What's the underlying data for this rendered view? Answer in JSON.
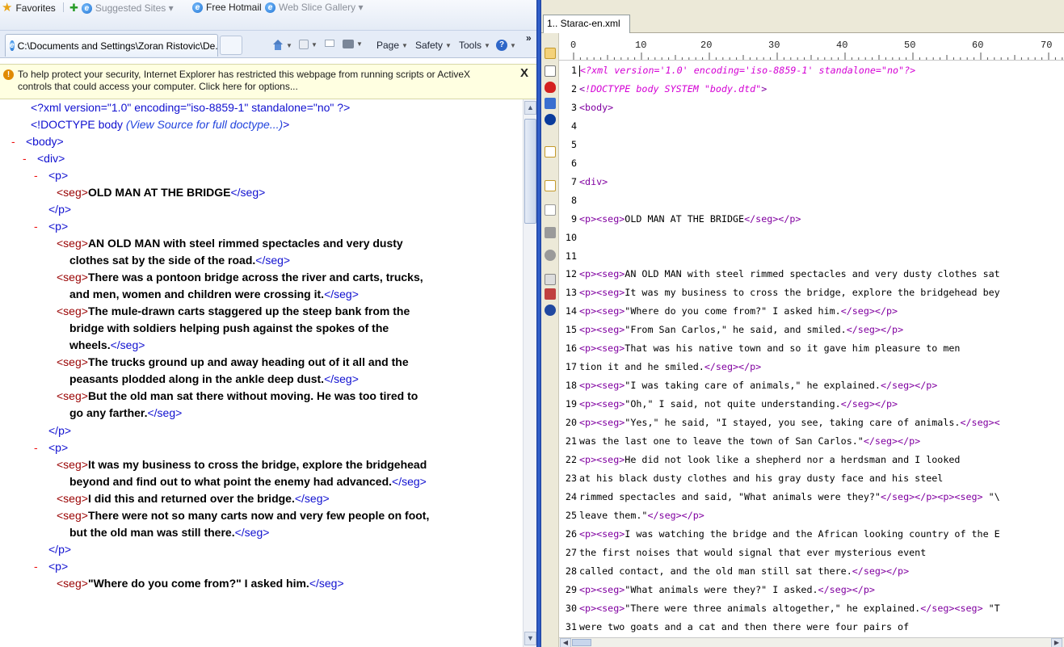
{
  "ie": {
    "favorites_bar": {
      "favorites_label": "Favorites",
      "suggested_sites": "Suggested Sites ▾",
      "free_hotmail": "Free Hotmail",
      "web_slice_gallery": "Web Slice Gallery ▾"
    },
    "tab": {
      "title": "C:\\Documents and Settings\\Zoran Ristovic\\De..."
    },
    "command_bar": {
      "page": "Page",
      "safety": "Safety",
      "tools": "Tools",
      "overflow": "»"
    },
    "info_bar": {
      "message": "To help protect your security, Internet Explorer has restricted this webpage from running scripts or ActiveX controls that could access your computer. Click here for options...",
      "close": "X"
    },
    "xml": {
      "decl": "<?xml version=\"1.0\" encoding=\"iso-8859-1\" standalone=\"no\" ?>",
      "doctype_open": "<!DOCTYPE body ",
      "doctype_note": "(View Source for full doctype...)",
      "doctype_close": ">",
      "collapse_marker": "-",
      "body_open": "<body>",
      "div_open": "<div>",
      "p_open": "<p>",
      "p_close": "</p>",
      "seg_open": "<seg>",
      "seg_close": "</seg>",
      "segs": [
        "OLD MAN AT THE BRIDGE",
        "AN OLD MAN with steel rimmed spectacles and very dusty",
        "clothes sat by the side of the road.",
        "There was a pontoon bridge across the river and carts, trucks,",
        "and men, women and children were crossing it.",
        "The mule-drawn carts staggered up the steep bank from the",
        "bridge with soldiers helping push against the spokes of the",
        "wheels.",
        "The trucks ground up and away heading out of it all and the",
        "peasants plodded along in the ankle deep dust.",
        "But the old man sat there without moving. He was too tired to",
        "go any farther.",
        "It was my business to cross the bridge, explore the bridgehead",
        "beyond and find out to what point the enemy had advanced.",
        "I did this and returned over the bridge.",
        "There were not so many carts now and very few people on foot,",
        "but the old man was still there.",
        "\"Where do you come from?\" I asked him."
      ]
    }
  },
  "editor": {
    "tab_title": "1.. Starac-en.xml",
    "ruler_labels": [
      "0",
      "10",
      "20",
      "30",
      "40",
      "50",
      "60",
      "70"
    ],
    "lines": [
      {
        "n": "1",
        "parts": [
          {
            "c": "pi",
            "t": "<?xml version='1.0' encoding='iso-8859-1' standalone=\"no\"?>"
          }
        ]
      },
      {
        "n": "2",
        "parts": [
          {
            "c": "mt",
            "t": "<"
          },
          {
            "c": "pi",
            "t": "!DOCTYPE body SYSTEM \"body.dtd\""
          },
          {
            "c": "mt",
            "t": ">"
          }
        ]
      },
      {
        "n": "3",
        "parts": [
          {
            "c": "mt",
            "t": "<body>"
          }
        ]
      },
      {
        "n": "4",
        "parts": []
      },
      {
        "n": "5",
        "parts": []
      },
      {
        "n": "6",
        "parts": []
      },
      {
        "n": "7",
        "parts": [
          {
            "c": "mt",
            "t": "<div>"
          }
        ]
      },
      {
        "n": "8",
        "parts": []
      },
      {
        "n": "9",
        "parts": [
          {
            "c": "mt",
            "t": "<p><seg>"
          },
          {
            "c": "tx",
            "t": "OLD MAN AT THE BRIDGE"
          },
          {
            "c": "mt",
            "t": "</seg></p>"
          }
        ]
      },
      {
        "n": "10",
        "parts": []
      },
      {
        "n": "11",
        "parts": []
      },
      {
        "n": "12",
        "parts": [
          {
            "c": "mt",
            "t": "<p><seg>"
          },
          {
            "c": "tx",
            "t": "AN OLD MAN with steel rimmed spectacles and very dusty clothes sat"
          }
        ]
      },
      {
        "n": "13",
        "parts": [
          {
            "c": "mt",
            "t": "<p><seg>"
          },
          {
            "c": "tx",
            "t": "It was my business to cross the bridge, explore the bridgehead bey"
          }
        ]
      },
      {
        "n": "14",
        "parts": [
          {
            "c": "mt",
            "t": "<p><seg>"
          },
          {
            "c": "tx",
            "t": "\"Where do you come from?\" I asked him."
          },
          {
            "c": "mt",
            "t": "</seg></p>"
          }
        ]
      },
      {
        "n": "15",
        "parts": [
          {
            "c": "mt",
            "t": "<p><seg>"
          },
          {
            "c": "tx",
            "t": "\"From San Carlos,\" he said, and smiled."
          },
          {
            "c": "mt",
            "t": "</seg></p>"
          }
        ]
      },
      {
        "n": "16",
        "parts": [
          {
            "c": "mt",
            "t": "<p><seg>"
          },
          {
            "c": "tx",
            "t": "That was his native town and so it gave him pleasure to men"
          }
        ]
      },
      {
        "n": "17",
        "parts": [
          {
            "c": "tx",
            "t": "tion it and he smiled."
          },
          {
            "c": "mt",
            "t": "</seg></p>"
          }
        ]
      },
      {
        "n": "18",
        "parts": [
          {
            "c": "mt",
            "t": "<p><seg>"
          },
          {
            "c": "tx",
            "t": "\"I was taking care of animals,\" he explained."
          },
          {
            "c": "mt",
            "t": "</seg></p>"
          }
        ]
      },
      {
        "n": "19",
        "parts": [
          {
            "c": "mt",
            "t": "<p><seg>"
          },
          {
            "c": "tx",
            "t": "\"Oh,\" I said, not quite understanding."
          },
          {
            "c": "mt",
            "t": "</seg></p>"
          }
        ]
      },
      {
        "n": "20",
        "parts": [
          {
            "c": "mt",
            "t": "<p><seg>"
          },
          {
            "c": "tx",
            "t": "\"Yes,\" he said, \"I stayed, you see, taking care of animals."
          },
          {
            "c": "mt",
            "t": "</seg><"
          }
        ]
      },
      {
        "n": "21",
        "parts": [
          {
            "c": "tx",
            "t": "was the last one to leave the town of San Carlos.\""
          },
          {
            "c": "mt",
            "t": "</seg></p>"
          }
        ]
      },
      {
        "n": "22",
        "parts": [
          {
            "c": "mt",
            "t": "<p><seg>"
          },
          {
            "c": "tx",
            "t": "He did not look like a shepherd nor a herdsman and I looked"
          }
        ]
      },
      {
        "n": "23",
        "parts": [
          {
            "c": "tx",
            "t": "at his black dusty clothes and his gray dusty face and his steel"
          }
        ]
      },
      {
        "n": "24",
        "parts": [
          {
            "c": "tx",
            "t": "rimmed spectacles and said, \"What animals were they?\""
          },
          {
            "c": "mt",
            "t": "</seg></p><p><seg>"
          },
          {
            "c": "tx",
            "t": " \"\\"
          }
        ]
      },
      {
        "n": "25",
        "parts": [
          {
            "c": "tx",
            "t": "leave them.\""
          },
          {
            "c": "mt",
            "t": "</seg></p>"
          }
        ]
      },
      {
        "n": "26",
        "parts": [
          {
            "c": "mt",
            "t": "<p><seg>"
          },
          {
            "c": "tx",
            "t": "I was watching the bridge and the African looking country of the E"
          }
        ]
      },
      {
        "n": "27",
        "parts": [
          {
            "c": "tx",
            "t": "the first noises that would signal that ever mysterious event"
          }
        ]
      },
      {
        "n": "28",
        "parts": [
          {
            "c": "tx",
            "t": "called contact, and the old man still sat there."
          },
          {
            "c": "mt",
            "t": "</seg></p>"
          }
        ]
      },
      {
        "n": "29",
        "parts": [
          {
            "c": "mt",
            "t": "<p><seg>"
          },
          {
            "c": "tx",
            "t": "\"What animals were they?\" I asked."
          },
          {
            "c": "mt",
            "t": "</seg></p>"
          }
        ]
      },
      {
        "n": "30",
        "parts": [
          {
            "c": "mt",
            "t": "<p><seg>"
          },
          {
            "c": "tx",
            "t": "\"There were three animals altogether,\" he explained."
          },
          {
            "c": "mt",
            "t": "</seg><seg>"
          },
          {
            "c": "tx",
            "t": " \"T"
          }
        ]
      },
      {
        "n": "31",
        "parts": [
          {
            "c": "tx",
            "t": "were two goats and a cat and then there were four pairs of"
          }
        ]
      }
    ]
  },
  "colors": {
    "divider": "#2a55c4",
    "pi_magenta": "#d400d4",
    "markup_purple": "#8000a0",
    "ie_tag_blue": "#1010d0",
    "ie_tag_red": "#990000",
    "collapse_red": "#ee1111",
    "info_bar_bg": "#ffffe1"
  }
}
